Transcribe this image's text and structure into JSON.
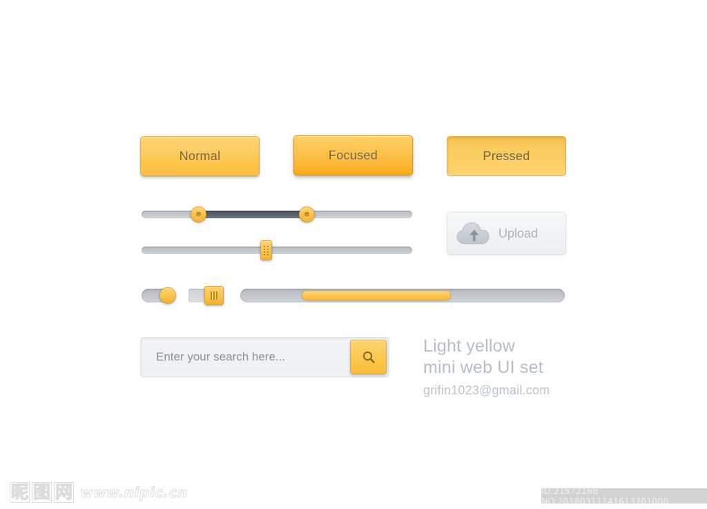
{
  "meta": {
    "kit_title_line1": "Light yellow",
    "kit_title_line2": "mini web UI set",
    "author_email": "grifin1023@gmail.com",
    "accent_yellow": "#f9c44e",
    "accent_yellow_dark": "#f8a61c",
    "track_gray": "#c3c8ce",
    "fill_dark": "#5a626e",
    "text_gray": "#b8bcc4",
    "button_text": "#7c6030"
  },
  "buttons": [
    {
      "name": "normal",
      "label": "Normal",
      "state": "normal"
    },
    {
      "name": "focused",
      "label": "Focused",
      "state": "focused"
    },
    {
      "name": "pressed",
      "label": "Pressed",
      "state": "pressed"
    }
  ],
  "sliders": {
    "range_slider": {
      "name": "dual-handle-range-slider",
      "min": 0,
      "max": 100,
      "low_value": 21,
      "high_value": 61,
      "handle_style": "round"
    },
    "single_slider": {
      "name": "single-handle-slider",
      "min": 0,
      "max": 100,
      "value": 46,
      "handle_style": "rectangular-grip"
    }
  },
  "upload": {
    "label": "Upload",
    "icon": "cloud-upload-icon"
  },
  "toggles": [
    {
      "name": "toggle-round",
      "state": "on",
      "knob": "round"
    },
    {
      "name": "toggle-square",
      "state": "on",
      "knob": "square-grip"
    }
  ],
  "progress": {
    "name": "progress-range-bar",
    "start_percent": 19,
    "end_percent": 65
  },
  "search": {
    "placeholder": "Enter your search here...",
    "value": "",
    "button_icon": "search-icon"
  },
  "footer": {
    "watermark_chars": [
      "昵",
      "图",
      "网"
    ],
    "watermark_url": "www.nipic.cn",
    "id_text": "ID:21572168 NO:20180311141613701000"
  }
}
